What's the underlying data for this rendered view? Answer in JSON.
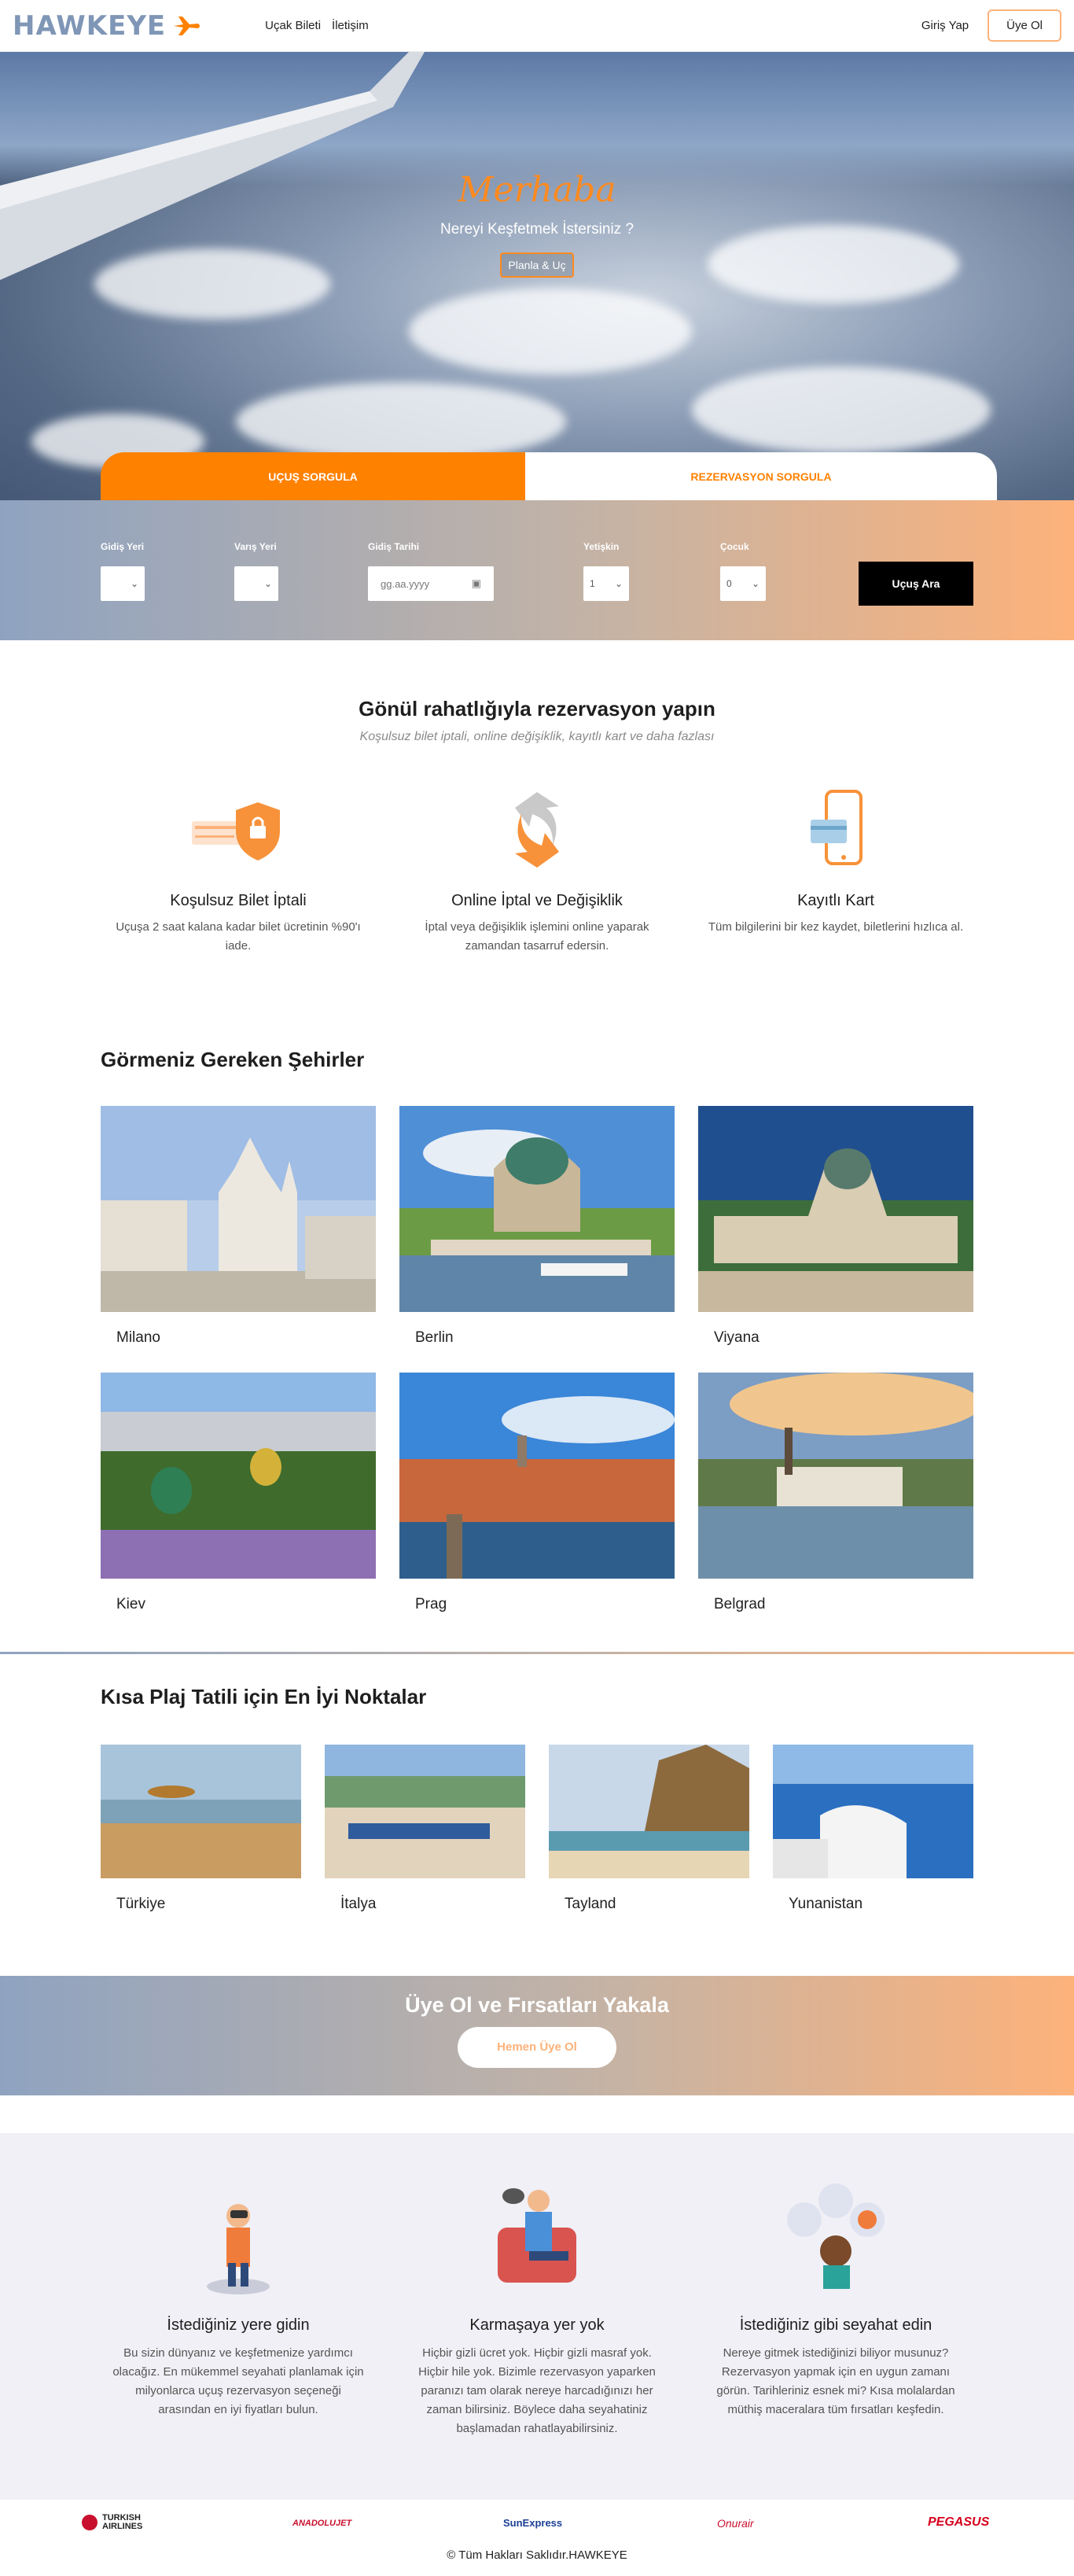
{
  "header": {
    "logo": "HAWKEYE",
    "nav": [
      "Uçak Bileti",
      "İletişim"
    ],
    "login": "Giriş Yap",
    "signup": "Üye Ol"
  },
  "hero": {
    "greeting": "Merhaba",
    "subtitle": "Nereyi Keşfetmek İstersiniz ?",
    "button": "Planla & Uç"
  },
  "tabs": {
    "flight": "UÇUŞ SORGULA",
    "reservation": "REZERVASYON SORGULA"
  },
  "search": {
    "from_label": "Gidiş Yeri",
    "to_label": "Varış Yeri",
    "date_label": "Gidiş Tarihi",
    "date_placeholder": "gg.aa.yyyy",
    "adult_label": "Yetişkin",
    "adult_value": "1",
    "child_label": "Çocuk",
    "child_value": "0",
    "submit": "Uçuş Ara"
  },
  "features": {
    "title": "Gönül rahatlığıyla rezervasyon yapın",
    "subtitle": "Koşulsuz bilet iptali, online değişiklik, kayıtlı kart ve daha fazlası",
    "items": [
      {
        "title": "Koşulsuz Bilet İptali",
        "text": "Uçuşa 2 saat kalana kadar bilet ücretinin %90'ı iade.",
        "icon": "lock-shield-icon"
      },
      {
        "title": "Online İptal ve Değişiklik",
        "text": "İptal veya değişiklik işlemini online yaparak zamandan tasarruf edersin.",
        "icon": "refresh-icon"
      },
      {
        "title": "Kayıtlı Kart",
        "text": "Tüm bilgilerini bir kez kaydet, biletlerini hızlıca al.",
        "icon": "phone-card-icon"
      }
    ]
  },
  "cities": {
    "title": "Görmeniz Gereken Şehirler",
    "items": [
      "Milano",
      "Berlin",
      "Viyana",
      "Kiev",
      "Prag",
      "Belgrad"
    ]
  },
  "beaches": {
    "title": "Kısa Plaj Tatili için En İyi Noktalar",
    "items": [
      "Türkiye",
      "İtalya",
      "Tayland",
      "Yunanistan"
    ]
  },
  "band": {
    "title": "Üye Ol ve Fırsatları Yakala",
    "button": "Hemen Üye Ol"
  },
  "why": [
    {
      "title": "İstediğiniz yere gidin",
      "text": "Bu sizin dünyanız ve keşfetmenize yardımcı olacağız. En mükemmel seyahati planlamak için milyonlarca uçuş rezervasyon seçeneği arasından en iyi fiyatları bulun."
    },
    {
      "title": "Karmaşaya yer yok",
      "text": "Hiçbir gizli ücret yok. Hiçbir gizli masraf yok. Hiçbir hile yok. Bizimle rezervasyon yaparken paranızı tam olarak nereye harcadığınızı her zaman bilirsiniz. Böylece daha seyahatiniz başlamadan rahatlayabilirsiniz."
    },
    {
      "title": "İstediğiniz gibi seyahat edin",
      "text": "Nereye gitmek istediğinizi biliyor musunuz? Rezervasyon yapmak için en uygun zamanı görün. Tarihleriniz esnek mi? Kısa molalardan müthiş maceralara tüm fırsatları keşfedin."
    }
  ],
  "airlines": [
    "TURKISH AIRLINES",
    "ANADOLUJET",
    "SunExpress",
    "Onurair",
    "PEGASUS"
  ],
  "footer": "© Tüm Hakları Saklıdır.HAWKEYE",
  "colors": {
    "accent": "#ff8100",
    "brand": "#7f96b6",
    "peach": "#fdb27a"
  }
}
